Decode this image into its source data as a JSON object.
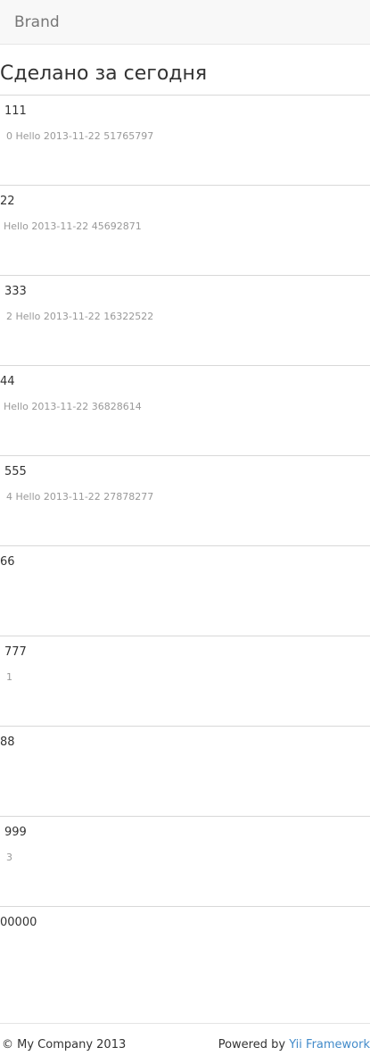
{
  "navbar": {
    "brand": "Brand"
  },
  "page": {
    "title": "Сделано за сегодня"
  },
  "tasks": [
    {
      "title": "111",
      "subtitle": "0 Hello 2013-11-22 51765797"
    },
    {
      "title": "22",
      "subtitle": "Hello 2013-11-22 45692871"
    },
    {
      "title": "333",
      "subtitle": "2 Hello 2013-11-22 16322522"
    },
    {
      "title": "44",
      "subtitle": "Hello 2013-11-22 36828614"
    },
    {
      "title": "555",
      "subtitle": "4 Hello 2013-11-22 27878277"
    },
    {
      "title": "66",
      "subtitle": ""
    },
    {
      "title": "777",
      "subtitle": "1"
    },
    {
      "title": "88",
      "subtitle": ""
    },
    {
      "title": "999",
      "subtitle": "3"
    },
    {
      "title": "00000",
      "subtitle": ""
    }
  ],
  "footer": {
    "copyright": "© My Company 2013",
    "powered_prefix": "Powered by ",
    "powered_link": "Yii Framework"
  }
}
